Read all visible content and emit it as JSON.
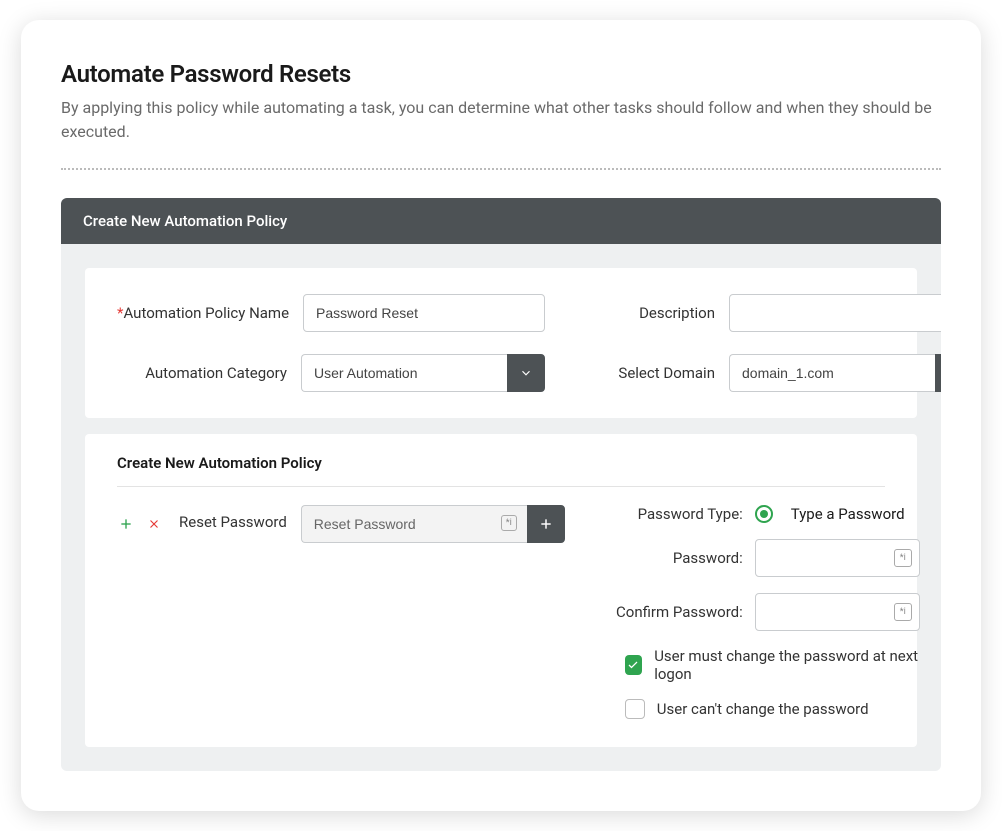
{
  "header": {
    "title": "Automate Password Resets",
    "subtitle": "By applying this policy while automating a task, you can determine what other tasks should follow and when they should be executed."
  },
  "panel": {
    "header": "Create New Automation Policy",
    "form": {
      "policy_name_label": "Automation Policy Name",
      "policy_name_value": "Password Reset",
      "description_label": "Description",
      "description_value": "",
      "category_label": "Automation Category",
      "category_value": "User Automation",
      "domain_label": "Select Domain",
      "domain_value": "domain_1.com"
    },
    "sub": {
      "heading": "Create New Automation Policy",
      "action_label": "Reset Password",
      "action_input_value": "Reset Password",
      "password_type_label": "Password Type:",
      "password_type_option": "Type a Password",
      "password_label": "Password:",
      "confirm_password_label": "Confirm Password:",
      "chk1_label": "User must change the password at next logon",
      "chk2_label": "User can't change the password"
    }
  }
}
